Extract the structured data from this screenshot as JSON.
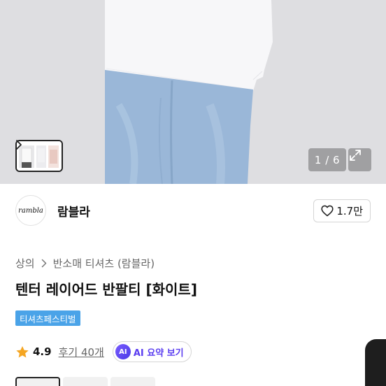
{
  "hero": {
    "image_counter": "1 / 6",
    "icons": {
      "thumbnail_next": "chevron-right-icon",
      "expand": "expand-icon"
    }
  },
  "brand": {
    "logo_text": "rambla",
    "name": "람블라",
    "likes": "1.7만",
    "icons": {
      "like": "heart-outline-icon"
    }
  },
  "breadcrumb": {
    "items": [
      "상의",
      "반소매 티셔츠 (람블라)"
    ]
  },
  "product": {
    "title": "텐터 레이어드 반팔티 [화이트]",
    "tag": "티셔츠페스티벌"
  },
  "rating": {
    "score": "4.9",
    "reviews": "후기 40개",
    "ai_badge": "AI",
    "ai_summary_label": "AI 요약 보기",
    "star_color": "#f5a623"
  },
  "colors": {
    "accent": "#4aa3e8",
    "ai": "#5a3df0"
  }
}
